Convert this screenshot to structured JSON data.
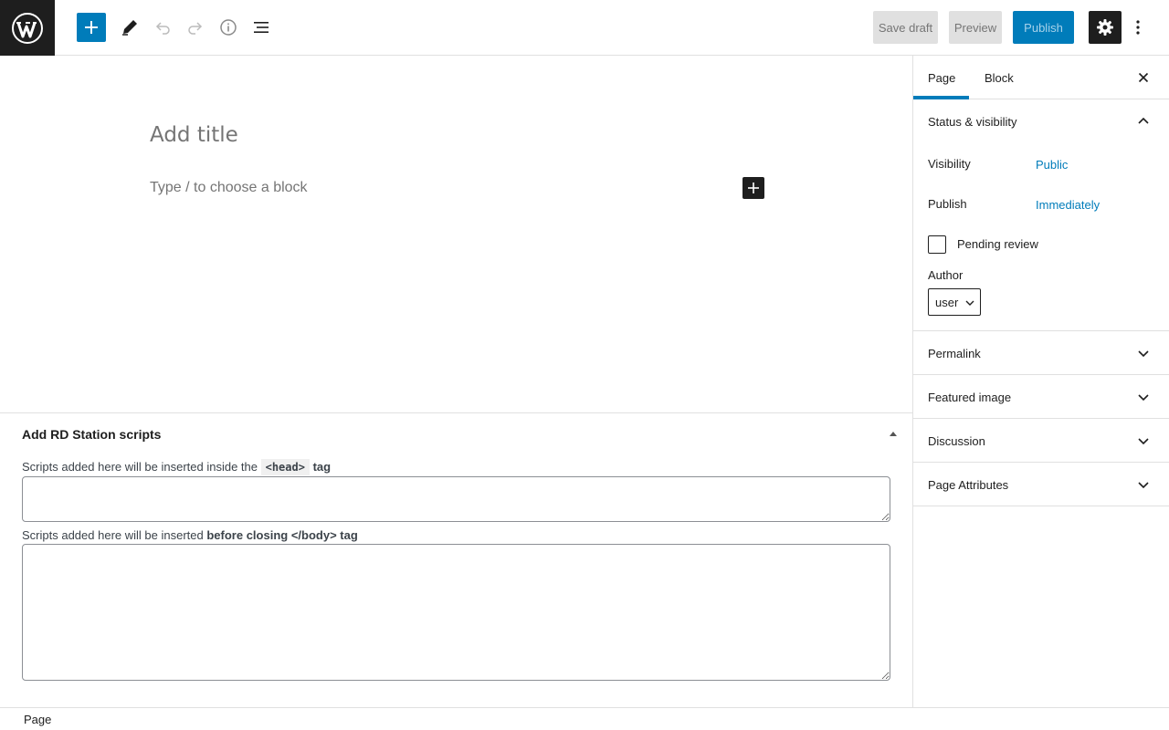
{
  "toolbar": {
    "save_draft": "Save draft",
    "preview": "Preview",
    "publish": "Publish",
    "icons": [
      "wordpress-logo",
      "add-block",
      "edit-tools",
      "undo",
      "redo",
      "details-info",
      "list-view",
      "settings-gear",
      "more-options"
    ]
  },
  "editor": {
    "title_placeholder": "Add title",
    "block_placeholder": "Type / to choose a block"
  },
  "metabox": {
    "title": "Add RD Station scripts",
    "head_label_prefix": "Scripts added here will be inserted inside the",
    "head_label_code": "<head>",
    "head_label_suffix": "tag",
    "head_value": "",
    "body_label_prefix": "Scripts added here will be inserted",
    "body_label_bold": "before closing </body> tag",
    "body_value": ""
  },
  "sidebar": {
    "tabs": [
      "Page",
      "Block"
    ],
    "active_tab": "Page",
    "status_visibility": {
      "title": "Status & visibility",
      "visibility_label": "Visibility",
      "visibility_value": "Public",
      "publish_label": "Publish",
      "publish_value": "Immediately",
      "pending_review": "Pending review",
      "author_label": "Author",
      "author_value": "user"
    },
    "panels": [
      "Permalink",
      "Featured image",
      "Discussion",
      "Page Attributes"
    ]
  },
  "footer": {
    "breadcrumb": "Page"
  },
  "colors": {
    "accent": "#007cba",
    "dark": "#1e1e1e",
    "border": "#e0e0e0",
    "placeholder": "#757575"
  }
}
